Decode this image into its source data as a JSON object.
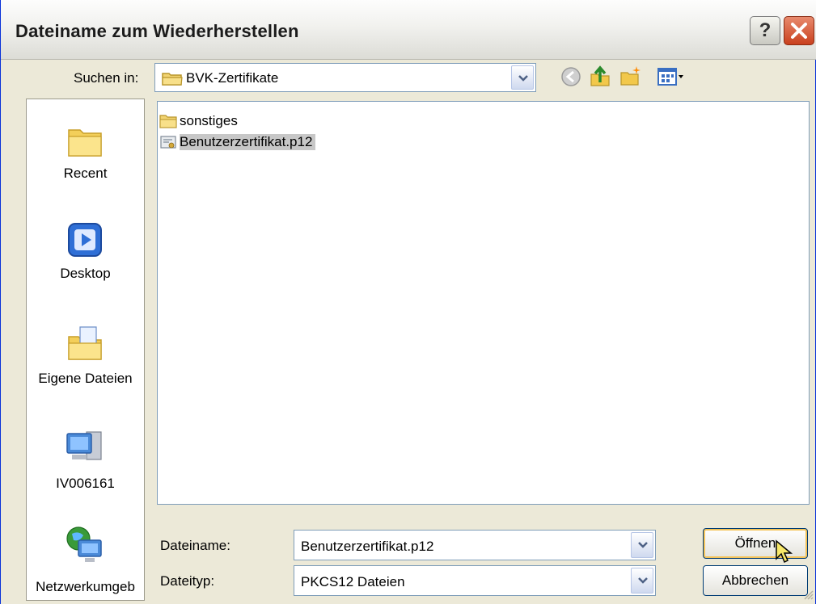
{
  "window": {
    "title": "Dateiname zum Wiederherstellen"
  },
  "lookin": {
    "label": "Suchen in:",
    "value": "BVK-Zertifikate"
  },
  "places": [
    {
      "label": "Recent"
    },
    {
      "label": "Desktop"
    },
    {
      "label": "Eigene Dateien"
    },
    {
      "label": "IV006161"
    },
    {
      "label": "Netzwerkumgeb"
    }
  ],
  "files": [
    {
      "name": "sonstiges",
      "type": "folder",
      "selected": false
    },
    {
      "name": "Benutzerzertifikat.p12",
      "type": "certificate",
      "selected": true
    }
  ],
  "filename": {
    "label": "Dateiname:",
    "value": "Benutzerzertifikat.p12"
  },
  "filetype": {
    "label": "Dateityp:",
    "value": "PKCS12 Dateien"
  },
  "buttons": {
    "open": "Öffnen",
    "cancel": "Abbrechen",
    "help": "?"
  }
}
